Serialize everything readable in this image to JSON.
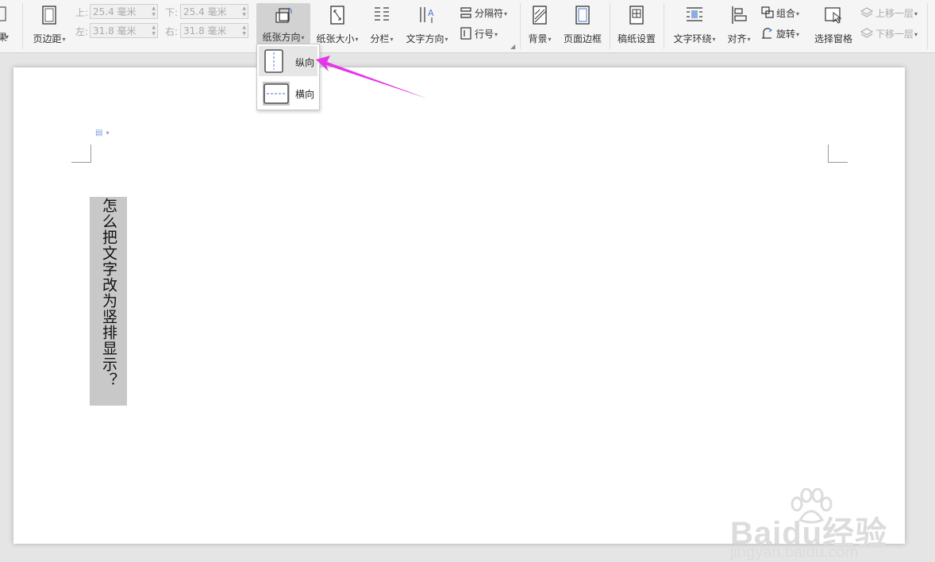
{
  "ribbon": {
    "effects_partial": "果",
    "margins_label": "页边距",
    "top_label": "上:",
    "top_value": "25.4 毫米",
    "bottom_label": "下:",
    "bottom_value": "25.4 毫米",
    "left_label": "左:",
    "left_value": "31.8 毫米",
    "right_label": "右:",
    "right_value": "31.8 毫米",
    "orientation_label": "纸张方向",
    "size_label": "纸张大小",
    "columns_label": "分栏",
    "text_direction_label": "文字方向",
    "separator_label": "分隔符",
    "line_number_label": "行号",
    "background_label": "背景",
    "page_border_label": "页面边框",
    "manuscript_label": "稿纸设置",
    "text_wrap_label": "文字环绕",
    "align_label": "对齐",
    "group_label": "组合",
    "rotate_label": "旋转",
    "selection_pane_label": "选择窗格",
    "bring_forward_label": "上移一层",
    "send_backward_label": "下移一层"
  },
  "orientation_menu": {
    "portrait_label": "纵向",
    "landscape_label": "横向"
  },
  "document": {
    "vertical_text": "怎么把文字改为竖排显示？"
  },
  "watermark": {
    "brand": "Baidu经验",
    "url": "jingyan.baidu.com"
  },
  "colors": {
    "arrow": "#e535e8",
    "text_box_fill": "#c8c8c8",
    "active_button": "#d2d2d2"
  }
}
